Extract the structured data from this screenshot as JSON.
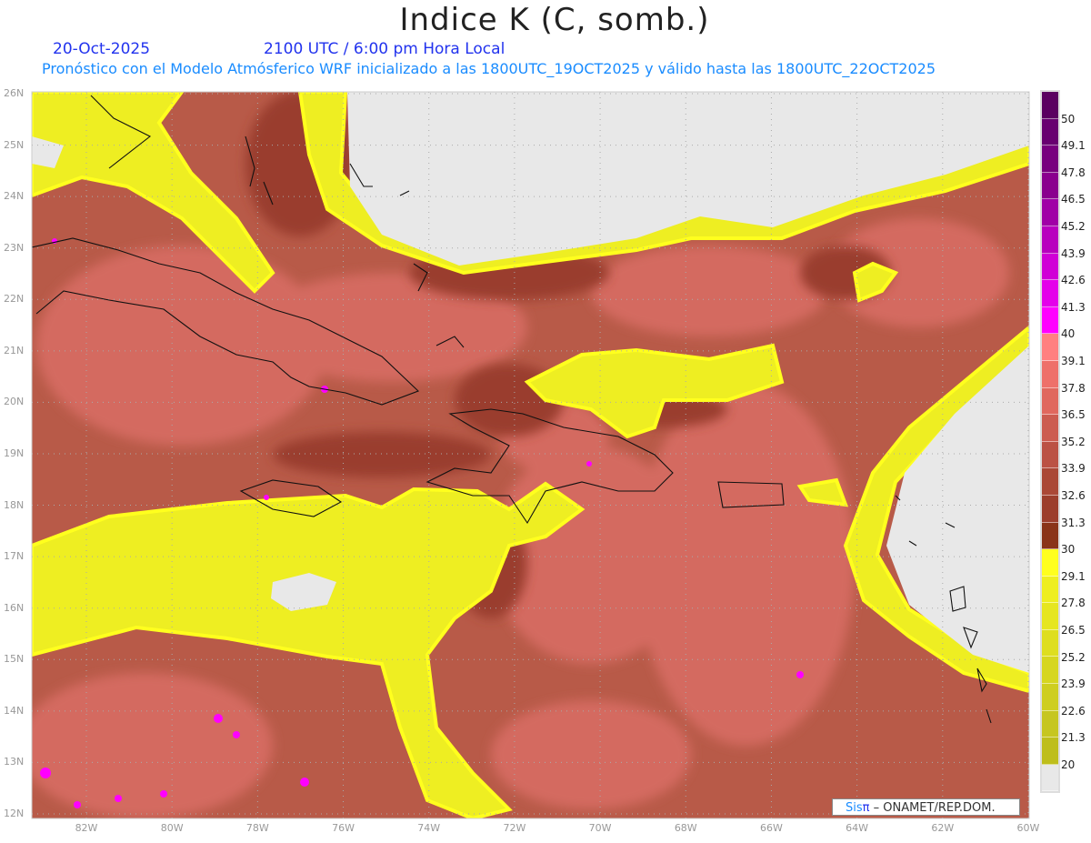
{
  "header": {
    "title": "Indice K (C, somb.)",
    "date": "20-Oct-2025",
    "time": "2100 UTC / 6:00 pm Hora Local",
    "subtitle": "Pronóstico con el Modelo Atmósferico WRF inicializado a las 1800UTC_19OCT2025 y válido hasta las  1800UTC_22OCT2025"
  },
  "axes": {
    "lat_labels": [
      "26N",
      "25N",
      "24N",
      "23N",
      "22N",
      "21N",
      "20N",
      "19N",
      "18N",
      "17N",
      "16N",
      "15N",
      "14N",
      "13N",
      "12N"
    ],
    "lon_labels": [
      "82W",
      "80W",
      "78W",
      "76W",
      "74W",
      "72W",
      "70W",
      "68W",
      "66W",
      "64W",
      "62W",
      "60W"
    ]
  },
  "colorbar": {
    "labels": [
      "50",
      "49.1",
      "47.8",
      "46.5",
      "45.2",
      "43.9",
      "42.6",
      "41.3",
      "40",
      "39.1",
      "37.8",
      "36.5",
      "35.2",
      "33.9",
      "32.6",
      "31.3",
      "30",
      "29.1",
      "27.8",
      "26.5",
      "25.2",
      "23.9",
      "22.6",
      "21.3",
      "20"
    ],
    "colors": [
      "#5a0060",
      "#680070",
      "#78007e",
      "#8a008e",
      "#a000a6",
      "#b800be",
      "#d000d6",
      "#e400ea",
      "#ff00ff",
      "#ff8080",
      "#ee706a",
      "#e0685e",
      "#cc5c50",
      "#bb5244",
      "#aa4836",
      "#9c3e2c",
      "#8a3418",
      "#ffff1e",
      "#eeee20",
      "#e6e620",
      "#dede20",
      "#d6d620",
      "#cece20",
      "#c6c620",
      "#bebe1c",
      "#e8e8e8"
    ]
  },
  "credit": {
    "sis": "Sis",
    "pi": "π",
    "rest": " –  ONAMET/REP.DOM."
  }
}
